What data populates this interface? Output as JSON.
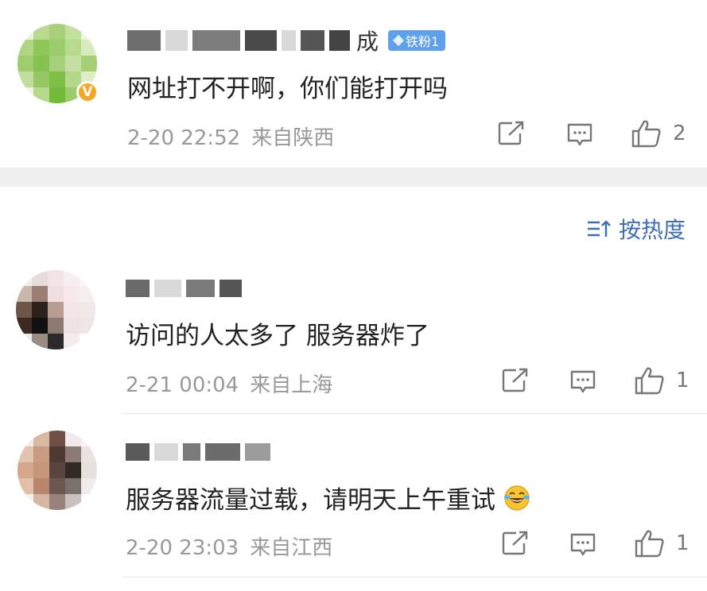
{
  "comments": [
    {
      "username_visible_tail": "成",
      "fan_badge": "铁粉1",
      "verified": "V",
      "text": "网址打不开啊，你们能打开吗",
      "date": "2-20 22:52",
      "location": "来自陕西",
      "likes": "2"
    },
    {
      "text": "访问的人太多了 服务器炸了",
      "date": "2-21 00:04",
      "location": "来自上海",
      "likes": "1"
    },
    {
      "text": "服务器流量过载，请明天上午重试",
      "date": "2-20 23:03",
      "location": "来自江西",
      "likes": "1"
    }
  ],
  "sort": {
    "label": "按热度"
  },
  "icons": [
    "share-icon",
    "comment-icon",
    "like-icon",
    "sort-icon",
    "laughing-emoji"
  ],
  "colors": {
    "accent": "#3d6fb6",
    "fan_badge": "#5fa0ea",
    "verified": "#f5a623"
  }
}
